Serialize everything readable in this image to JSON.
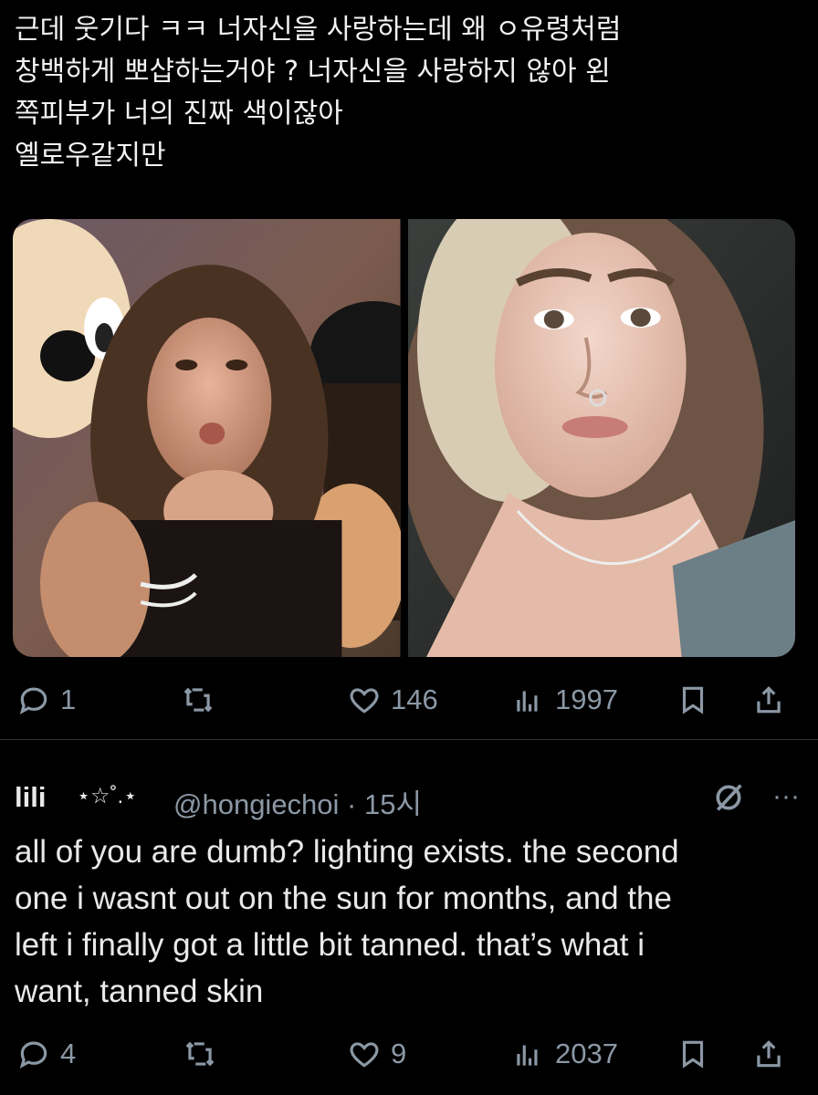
{
  "tweet": {
    "text": "근데 웃기다 ㅋㅋ 너자신을 사랑하는데 왜 ㅇ유령처럼\n창백하게 뽀샵하는거야 ? 너자신을 사랑하지 않아 왼\n쪽피부가 너의 진짜 색이잖아\n옐로우같지만",
    "replies": "1",
    "retweets": "",
    "likes": "146",
    "views": "1997"
  },
  "reply": {
    "name": "lili",
    "deco": "⋆☆˚.⋆",
    "handle": "@hongiechoi · 15시",
    "text": "all of you are dumb? lighting exists. the second\none i wasnt out on the sun for months, and the\nleft i finally got a little bit tanned. that’s what i\nwant, tanned skin",
    "replies": "4",
    "retweets": "",
    "likes": "9",
    "views": "2037",
    "more": "···"
  },
  "colors": {
    "background": "#000000",
    "text": "#e7e9ea",
    "muted": "#8b98a5",
    "divider": "#2f3336"
  },
  "icons": [
    "reply-icon",
    "retweet-icon",
    "like-icon",
    "views-icon",
    "bookmark-icon",
    "share-icon",
    "grok-icon",
    "more-icon"
  ]
}
